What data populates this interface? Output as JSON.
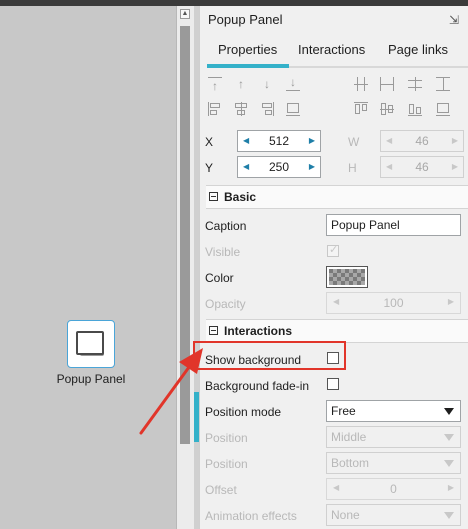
{
  "canvas": {
    "widget_label": "Popup Panel"
  },
  "panel": {
    "title": "Popup Panel",
    "tabs": [
      "Properties",
      "Interactions",
      "Page links"
    ],
    "geometry": {
      "x_label": "X",
      "x_value": "512",
      "y_label": "Y",
      "y_value": "250",
      "w_label": "W",
      "w_value": "46",
      "h_label": "H",
      "h_value": "46"
    },
    "basic": {
      "title": "Basic",
      "caption_label": "Caption",
      "caption_value": "Popup Panel",
      "visible_label": "Visible",
      "color_label": "Color",
      "opacity_label": "Opacity",
      "opacity_value": "100"
    },
    "interactions": {
      "title": "Interactions",
      "show_background_label": "Show background",
      "bg_fade_label": "Background fade-in",
      "position_mode_label": "Position mode",
      "position_mode_value": "Free",
      "position_h_label": "Position",
      "position_h_value": "Middle",
      "position_v_label": "Position",
      "position_v_value": "Bottom",
      "offset_label": "Offset",
      "offset_value": "0",
      "anim_label": "Animation effects",
      "anim_value": "None"
    }
  },
  "colors": {
    "accent": "#34b1c9",
    "highlight": "#e1352a"
  }
}
